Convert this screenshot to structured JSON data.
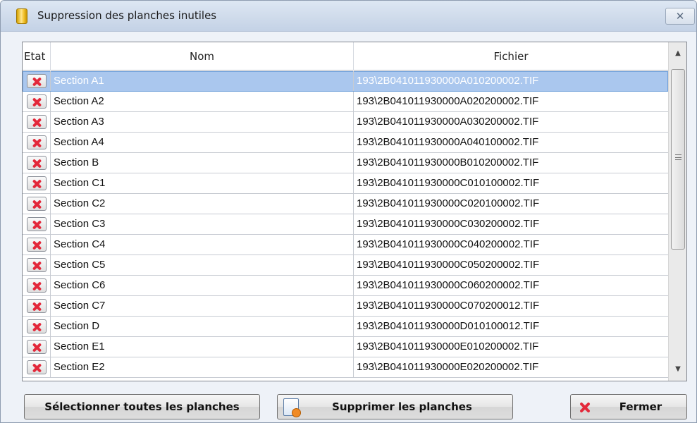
{
  "window": {
    "title": "Suppression des planches inutiles",
    "close_glyph": "✕",
    "icon": "folder-icon"
  },
  "table": {
    "columns": [
      "Etat",
      "Nom",
      "Fichier"
    ],
    "selected_row": 0,
    "rows": [
      {
        "etat": "delete-x-icon",
        "nom": "Section A1",
        "fichier": "193\\2B041011930000A010200002.TIF"
      },
      {
        "etat": "delete-x-icon",
        "nom": "Section A2",
        "fichier": "193\\2B041011930000A020200002.TIF"
      },
      {
        "etat": "delete-x-icon",
        "nom": "Section A3",
        "fichier": "193\\2B041011930000A030200002.TIF"
      },
      {
        "etat": "delete-x-icon",
        "nom": "Section A4",
        "fichier": "193\\2B041011930000A040100002.TIF"
      },
      {
        "etat": "delete-x-icon",
        "nom": "Section B",
        "fichier": "193\\2B041011930000B010200002.TIF"
      },
      {
        "etat": "delete-x-icon",
        "nom": "Section C1",
        "fichier": "193\\2B041011930000C010100002.TIF"
      },
      {
        "etat": "delete-x-icon",
        "nom": "Section C2",
        "fichier": "193\\2B041011930000C020100002.TIF"
      },
      {
        "etat": "delete-x-icon",
        "nom": "Section C3",
        "fichier": "193\\2B041011930000C030200002.TIF"
      },
      {
        "etat": "delete-x-icon",
        "nom": "Section C4",
        "fichier": "193\\2B041011930000C040200002.TIF"
      },
      {
        "etat": "delete-x-icon",
        "nom": "Section C5",
        "fichier": "193\\2B041011930000C050200002.TIF"
      },
      {
        "etat": "delete-x-icon",
        "nom": "Section C6",
        "fichier": "193\\2B041011930000C060200002.TIF"
      },
      {
        "etat": "delete-x-icon",
        "nom": "Section C7",
        "fichier": "193\\2B041011930000C070200012.TIF"
      },
      {
        "etat": "delete-x-icon",
        "nom": "Section D",
        "fichier": "193\\2B041011930000D010100012.TIF"
      },
      {
        "etat": "delete-x-icon",
        "nom": "Section E1",
        "fichier": "193\\2B041011930000E010200002.TIF"
      },
      {
        "etat": "delete-x-icon",
        "nom": "Section E2",
        "fichier": "193\\2B041011930000E020200002.TIF"
      }
    ]
  },
  "scrollbar": {
    "up_glyph": "▲",
    "down_glyph": "▼"
  },
  "buttons": {
    "select_all": "Sélectionner toutes les planches",
    "delete": "Supprimer les planches",
    "close": "Fermer"
  },
  "colors": {
    "selection": "#aac7ee",
    "delete_icon": "#e3283a",
    "window_bg": "#eef2f8"
  }
}
